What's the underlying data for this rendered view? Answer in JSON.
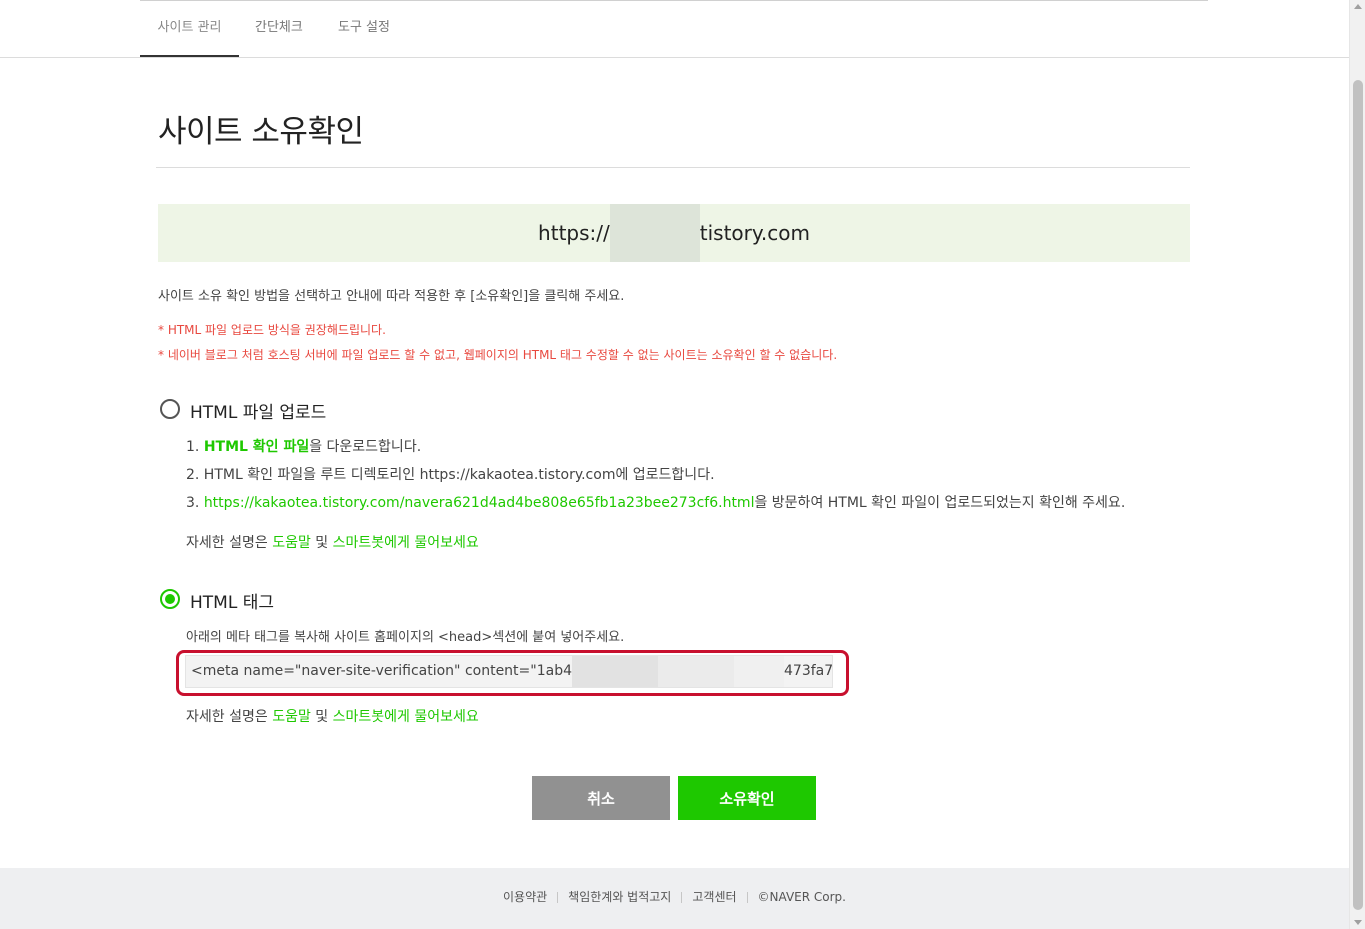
{
  "nav": {
    "tabs": [
      "사이트 관리",
      "간단체크",
      "도구 설정"
    ]
  },
  "page": {
    "title": "사이트 소유확인",
    "url_prefix": "https://",
    "url_suffix": "tistory.com",
    "intro": "사이트 소유 확인 방법을 선택하고 안내에 따라 적용한 후 [소유확인]을 클릭해 주세요.",
    "note1": "* HTML 파일 업로드 방식을 권장해드립니다.",
    "note2": "* 네이버 블로그 처럼 호스팅 서버에 파일 업로드 할 수 없고, 웹페이지의 HTML 태그 수정할 수 없는 사이트는 소유확인 할 수 없습니다."
  },
  "option_file": {
    "label": "HTML 파일 업로드",
    "selected": false,
    "step1_num": "1. ",
    "step1_link": "HTML 확인 파일",
    "step1_rest": "을 다운로드합니다.",
    "step2": "2. HTML 확인 파일을 루트 디렉토리인 https://kakaotea.tistory.com에 업로드합니다.",
    "step3_num": "3. ",
    "step3_link": "https://kakaotea.tistory.com/navera621d4ad4be808e65fb1a23bee273cf6.html",
    "step3_rest": "을 방문하여 HTML 확인 파일이 업로드되었는지 확인해 주세요.",
    "help_prefix": "자세한 설명은 ",
    "help_link1": "도움말",
    "help_mid": " 및 ",
    "help_link2": "스마트봇에게 물어보세요"
  },
  "option_tag": {
    "label": "HTML 태그",
    "selected": true,
    "desc": "아래의 메타 태그를 복사해 사이트 홈페이지의 <head>섹션에 붙여 넣어주세요.",
    "meta_prefix": "<meta name=\"naver-site-verification\" content=\"1ab4",
    "meta_suffix": "473fa7\" />",
    "help_prefix": "자세한 설명은 ",
    "help_link1": "도움말",
    "help_mid": " 및 ",
    "help_link2": "스마트봇에게 물어보세요"
  },
  "buttons": {
    "cancel": "취소",
    "confirm": "소유확인"
  },
  "footer": {
    "links": [
      "이용약관",
      "책임한계와 법적고지",
      "고객센터",
      "©NAVER Corp."
    ]
  },
  "colors": {
    "accent": "#1ec800",
    "warning": "#e8483f",
    "highlight_frame": "#c8102e",
    "url_bg": "#eef5e6",
    "cancel_bg": "#919191"
  }
}
